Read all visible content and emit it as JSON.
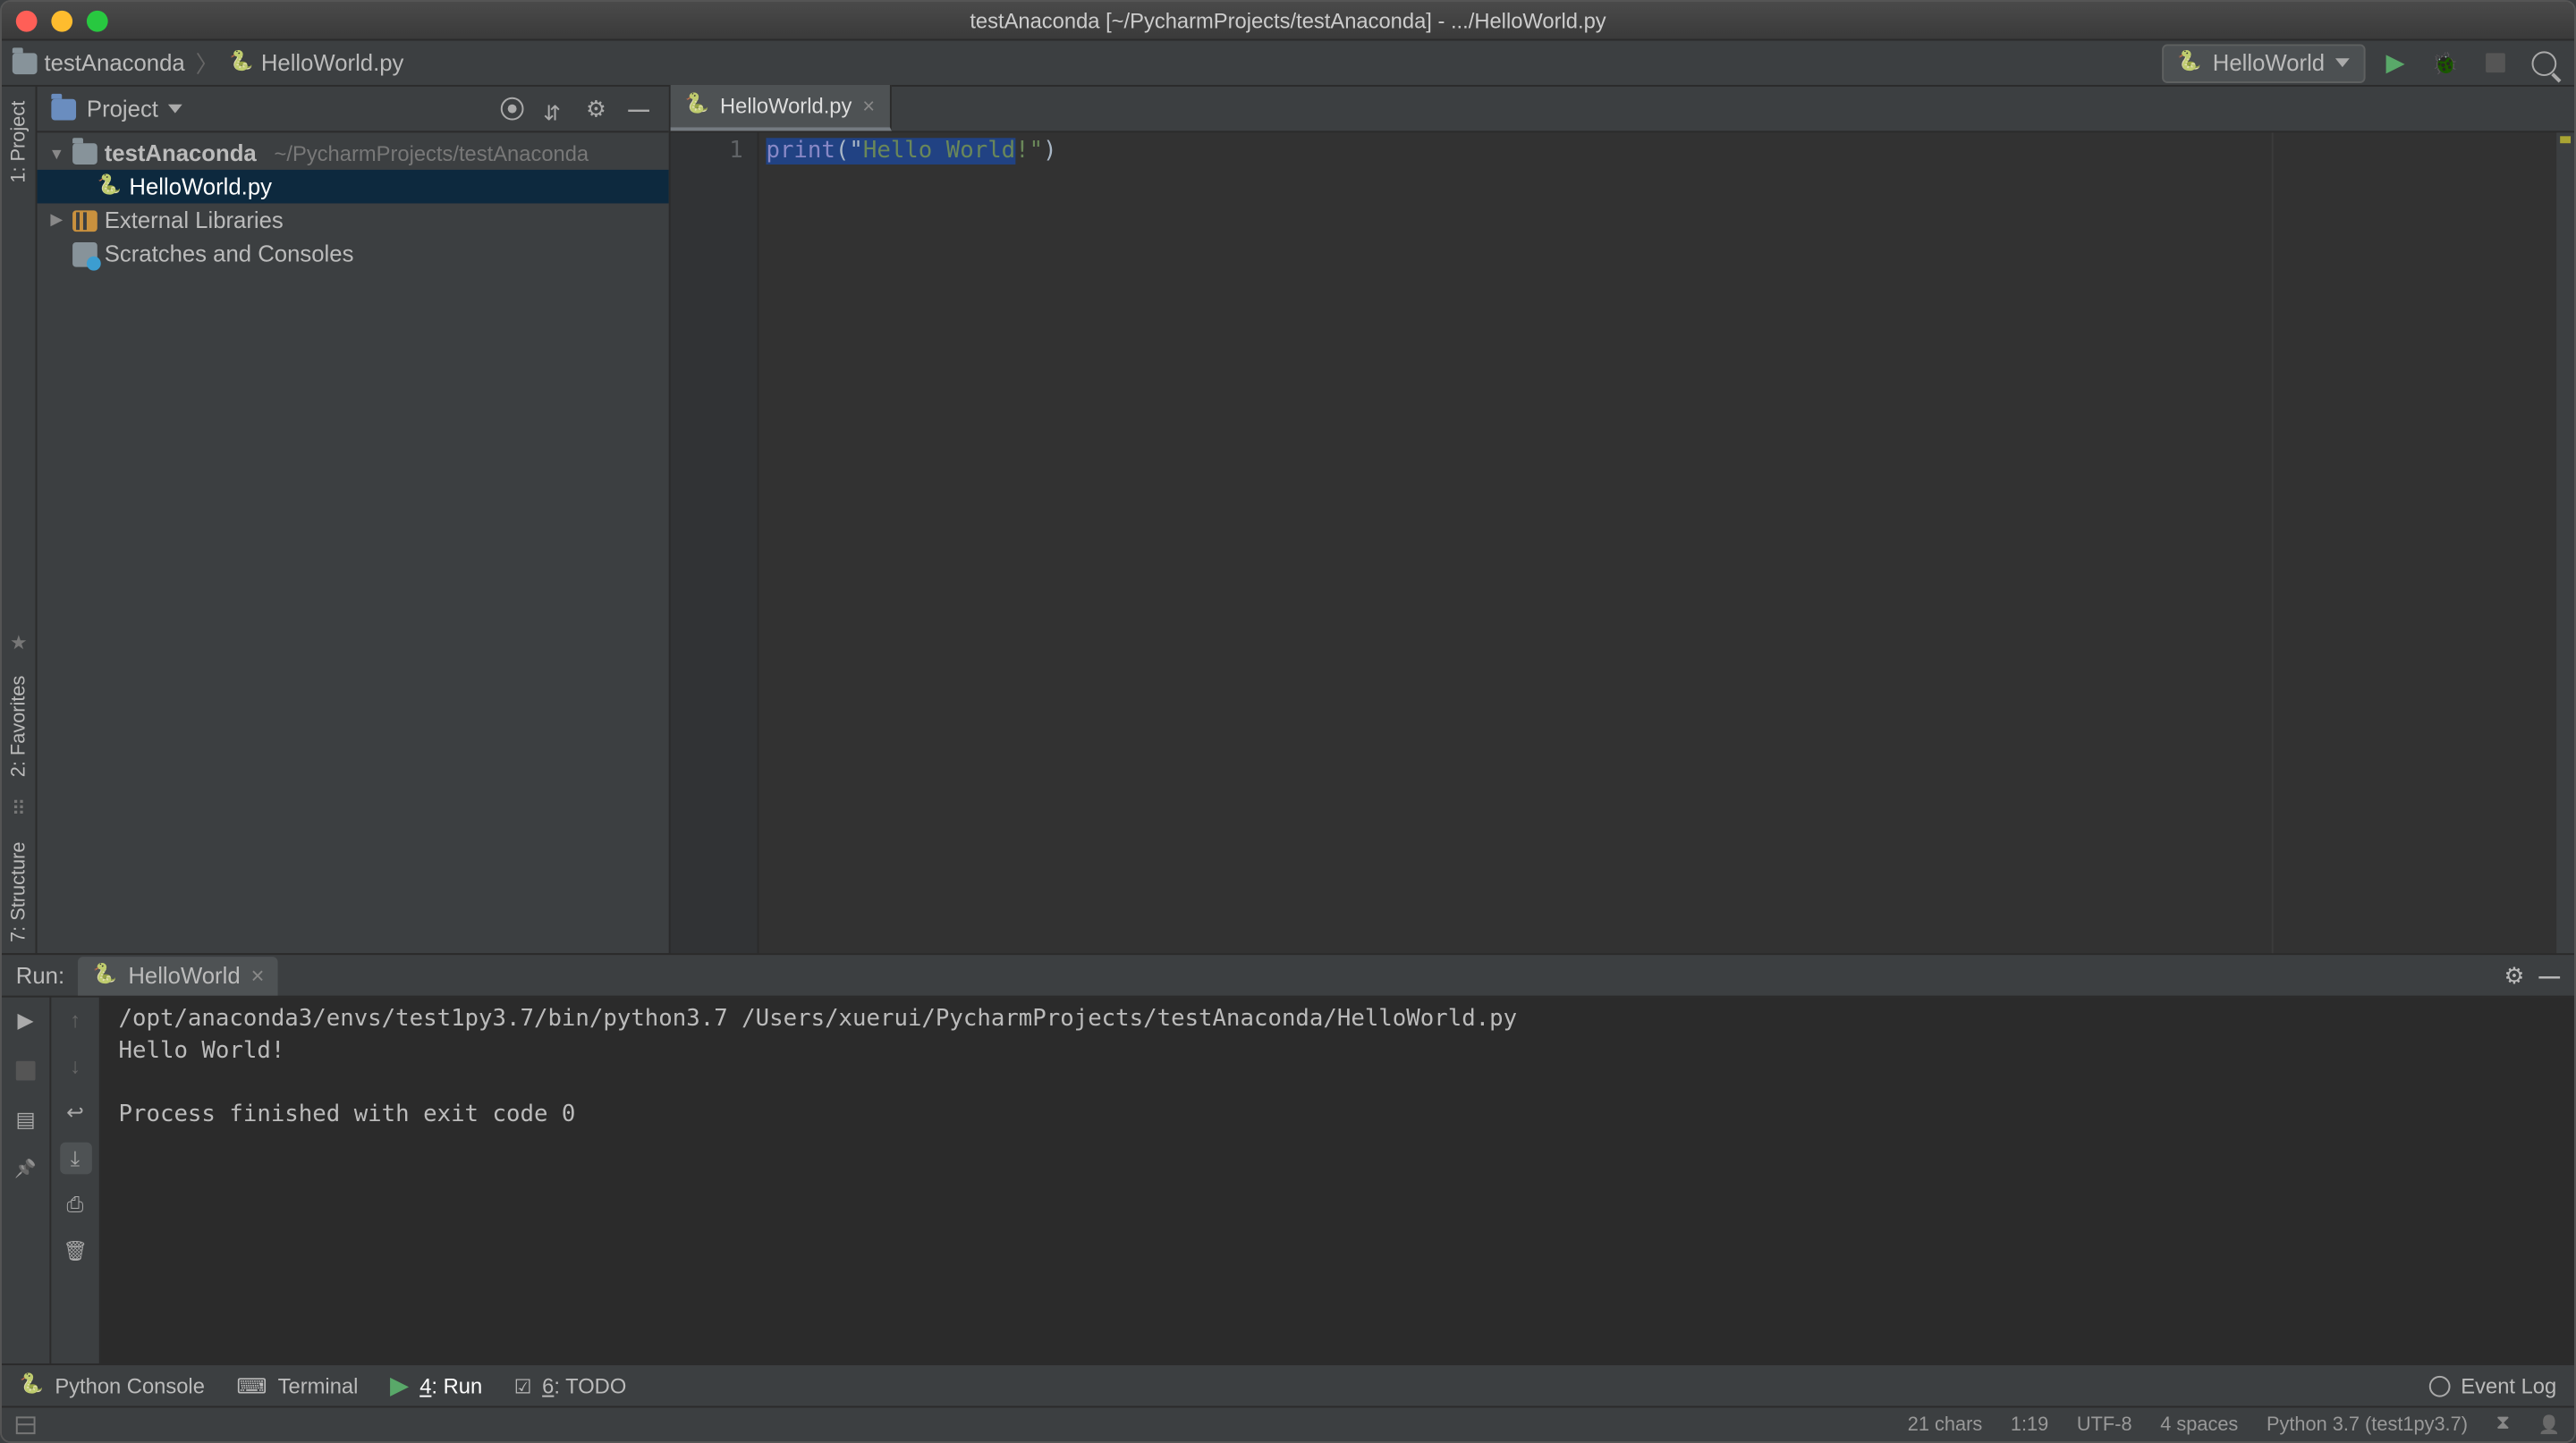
{
  "titlebar": {
    "title": "testAnaconda [~/PycharmProjects/testAnaconda] - .../HelloWorld.py"
  },
  "breadcrumb": {
    "project": "testAnaconda",
    "file": "HelloWorld.py"
  },
  "run_config": {
    "name": "HelloWorld"
  },
  "sidebar": {
    "head": "Project",
    "root": {
      "name": "testAnaconda",
      "path": "~/PycharmProjects/testAnaconda"
    },
    "file": "HelloWorld.py",
    "ext_lib": "External Libraries",
    "scratches": "Scratches and Consoles"
  },
  "editor": {
    "tab": "HelloWorld.py",
    "line_number": "1",
    "code": {
      "fn": "print",
      "open": "(\"",
      "str1": "Hello World",
      "str2": "!\"",
      "close": ")"
    }
  },
  "run_panel": {
    "label": "Run:",
    "tab": "HelloWorld",
    "output_line1": "/opt/anaconda3/envs/test1py3.7/bin/python3.7 /Users/xuerui/PycharmProjects/testAnaconda/HelloWorld.py",
    "output_line2": "Hello World!",
    "output_line3": "",
    "output_line4": "Process finished with exit code 0"
  },
  "tool_strip": {
    "python_console": "Python Console",
    "terminal": "Terminal",
    "run_prefix": "4",
    "run": ": Run",
    "todo_prefix": "6",
    "todo": ": TODO",
    "event_log": "Event Log"
  },
  "left_gutter": {
    "project": "1: Project",
    "favorites": "2: Favorites",
    "structure": "7: Structure"
  },
  "status": {
    "chars": "21 chars",
    "pos": "1:19",
    "encoding": "UTF-8",
    "indent": "4 spaces",
    "python": "Python 3.7 (test1py3.7)"
  }
}
